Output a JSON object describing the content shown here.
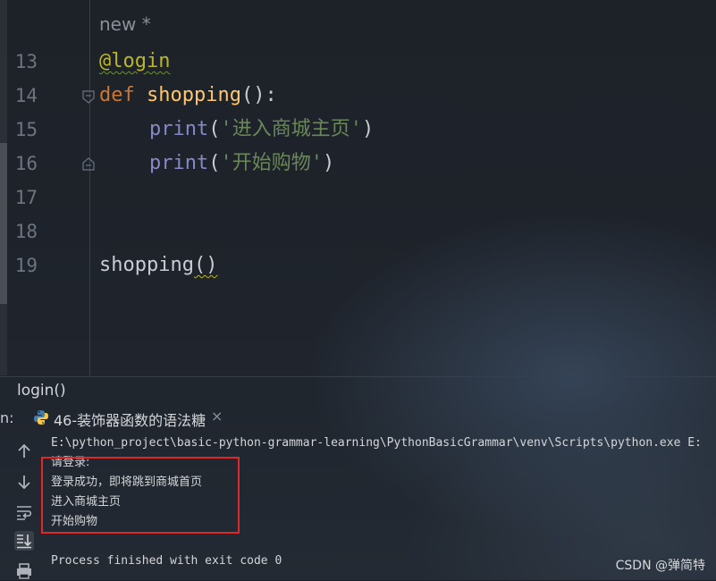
{
  "editor": {
    "hint_text": "new *",
    "lines": [
      {
        "number": "13",
        "text": "@login"
      },
      {
        "number": "14",
        "keyword": "def",
        "function": "shopping",
        "rest": "():"
      },
      {
        "number": "15",
        "call": "print",
        "open": "(",
        "string": "'进入商城主页'",
        "close": ")"
      },
      {
        "number": "16",
        "call": "print",
        "open": "(",
        "string": "'开始购物'",
        "close": ")"
      },
      {
        "number": "17"
      },
      {
        "number": "18"
      },
      {
        "number": "19",
        "function": "shopping",
        "rest": "()"
      }
    ]
  },
  "breadcrumb": {
    "label": "login()"
  },
  "run": {
    "label": "n:",
    "tab_title": "46-装饰器函数的语法糖",
    "tab_close": "×"
  },
  "toolbar": {
    "icons": [
      "arrow-up-icon",
      "arrow-down-icon",
      "soft-wrap-icon",
      "scroll-to-end-icon",
      "print-icon"
    ]
  },
  "console": {
    "command": "E:\\python_project\\basic-python-grammar-learning\\PythonBasicGrammar\\venv\\Scripts\\python.exe E:",
    "output": [
      "请登录:",
      "登录成功，即将跳到商城首页",
      "进入商城主页",
      "开始购物"
    ],
    "exit_message": "Process finished with exit code 0"
  },
  "watermark": "CSDN @弹简特",
  "colors": {
    "keyword": "#cc7832",
    "function": "#ffc66d",
    "decorator": "#bbb529",
    "string": "#6a8759",
    "builtin": "#8888c6",
    "highlight_box": "#e0272a"
  }
}
